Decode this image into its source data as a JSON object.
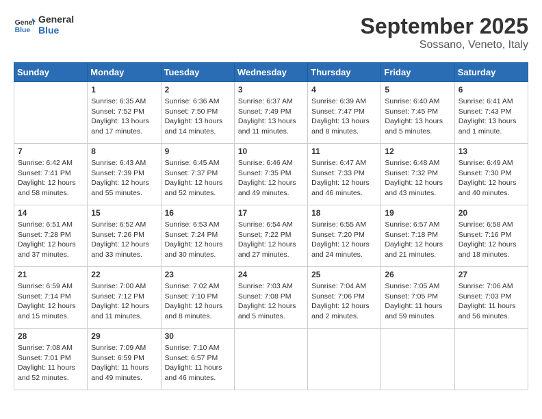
{
  "logo": {
    "text_general": "General",
    "text_blue": "Blue"
  },
  "header": {
    "month": "September 2025",
    "location": "Sossano, Veneto, Italy"
  },
  "weekdays": [
    "Sunday",
    "Monday",
    "Tuesday",
    "Wednesday",
    "Thursday",
    "Friday",
    "Saturday"
  ],
  "weeks": [
    [
      {
        "day": "",
        "sunrise": "",
        "sunset": "",
        "daylight": ""
      },
      {
        "day": "1",
        "sunrise": "Sunrise: 6:35 AM",
        "sunset": "Sunset: 7:52 PM",
        "daylight": "Daylight: 13 hours and 17 minutes."
      },
      {
        "day": "2",
        "sunrise": "Sunrise: 6:36 AM",
        "sunset": "Sunset: 7:50 PM",
        "daylight": "Daylight: 13 hours and 14 minutes."
      },
      {
        "day": "3",
        "sunrise": "Sunrise: 6:37 AM",
        "sunset": "Sunset: 7:49 PM",
        "daylight": "Daylight: 13 hours and 11 minutes."
      },
      {
        "day": "4",
        "sunrise": "Sunrise: 6:39 AM",
        "sunset": "Sunset: 7:47 PM",
        "daylight": "Daylight: 13 hours and 8 minutes."
      },
      {
        "day": "5",
        "sunrise": "Sunrise: 6:40 AM",
        "sunset": "Sunset: 7:45 PM",
        "daylight": "Daylight: 13 hours and 5 minutes."
      },
      {
        "day": "6",
        "sunrise": "Sunrise: 6:41 AM",
        "sunset": "Sunset: 7:43 PM",
        "daylight": "Daylight: 13 hours and 1 minute."
      }
    ],
    [
      {
        "day": "7",
        "sunrise": "Sunrise: 6:42 AM",
        "sunset": "Sunset: 7:41 PM",
        "daylight": "Daylight: 12 hours and 58 minutes."
      },
      {
        "day": "8",
        "sunrise": "Sunrise: 6:43 AM",
        "sunset": "Sunset: 7:39 PM",
        "daylight": "Daylight: 12 hours and 55 minutes."
      },
      {
        "day": "9",
        "sunrise": "Sunrise: 6:45 AM",
        "sunset": "Sunset: 7:37 PM",
        "daylight": "Daylight: 12 hours and 52 minutes."
      },
      {
        "day": "10",
        "sunrise": "Sunrise: 6:46 AM",
        "sunset": "Sunset: 7:35 PM",
        "daylight": "Daylight: 12 hours and 49 minutes."
      },
      {
        "day": "11",
        "sunrise": "Sunrise: 6:47 AM",
        "sunset": "Sunset: 7:33 PM",
        "daylight": "Daylight: 12 hours and 46 minutes."
      },
      {
        "day": "12",
        "sunrise": "Sunrise: 6:48 AM",
        "sunset": "Sunset: 7:32 PM",
        "daylight": "Daylight: 12 hours and 43 minutes."
      },
      {
        "day": "13",
        "sunrise": "Sunrise: 6:49 AM",
        "sunset": "Sunset: 7:30 PM",
        "daylight": "Daylight: 12 hours and 40 minutes."
      }
    ],
    [
      {
        "day": "14",
        "sunrise": "Sunrise: 6:51 AM",
        "sunset": "Sunset: 7:28 PM",
        "daylight": "Daylight: 12 hours and 37 minutes."
      },
      {
        "day": "15",
        "sunrise": "Sunrise: 6:52 AM",
        "sunset": "Sunset: 7:26 PM",
        "daylight": "Daylight: 12 hours and 33 minutes."
      },
      {
        "day": "16",
        "sunrise": "Sunrise: 6:53 AM",
        "sunset": "Sunset: 7:24 PM",
        "daylight": "Daylight: 12 hours and 30 minutes."
      },
      {
        "day": "17",
        "sunrise": "Sunrise: 6:54 AM",
        "sunset": "Sunset: 7:22 PM",
        "daylight": "Daylight: 12 hours and 27 minutes."
      },
      {
        "day": "18",
        "sunrise": "Sunrise: 6:55 AM",
        "sunset": "Sunset: 7:20 PM",
        "daylight": "Daylight: 12 hours and 24 minutes."
      },
      {
        "day": "19",
        "sunrise": "Sunrise: 6:57 AM",
        "sunset": "Sunset: 7:18 PM",
        "daylight": "Daylight: 12 hours and 21 minutes."
      },
      {
        "day": "20",
        "sunrise": "Sunrise: 6:58 AM",
        "sunset": "Sunset: 7:16 PM",
        "daylight": "Daylight: 12 hours and 18 minutes."
      }
    ],
    [
      {
        "day": "21",
        "sunrise": "Sunrise: 6:59 AM",
        "sunset": "Sunset: 7:14 PM",
        "daylight": "Daylight: 12 hours and 15 minutes."
      },
      {
        "day": "22",
        "sunrise": "Sunrise: 7:00 AM",
        "sunset": "Sunset: 7:12 PM",
        "daylight": "Daylight: 12 hours and 11 minutes."
      },
      {
        "day": "23",
        "sunrise": "Sunrise: 7:02 AM",
        "sunset": "Sunset: 7:10 PM",
        "daylight": "Daylight: 12 hours and 8 minutes."
      },
      {
        "day": "24",
        "sunrise": "Sunrise: 7:03 AM",
        "sunset": "Sunset: 7:08 PM",
        "daylight": "Daylight: 12 hours and 5 minutes."
      },
      {
        "day": "25",
        "sunrise": "Sunrise: 7:04 AM",
        "sunset": "Sunset: 7:06 PM",
        "daylight": "Daylight: 12 hours and 2 minutes."
      },
      {
        "day": "26",
        "sunrise": "Sunrise: 7:05 AM",
        "sunset": "Sunset: 7:05 PM",
        "daylight": "Daylight: 11 hours and 59 minutes."
      },
      {
        "day": "27",
        "sunrise": "Sunrise: 7:06 AM",
        "sunset": "Sunset: 7:03 PM",
        "daylight": "Daylight: 11 hours and 56 minutes."
      }
    ],
    [
      {
        "day": "28",
        "sunrise": "Sunrise: 7:08 AM",
        "sunset": "Sunset: 7:01 PM",
        "daylight": "Daylight: 11 hours and 52 minutes."
      },
      {
        "day": "29",
        "sunrise": "Sunrise: 7:09 AM",
        "sunset": "Sunset: 6:59 PM",
        "daylight": "Daylight: 11 hours and 49 minutes."
      },
      {
        "day": "30",
        "sunrise": "Sunrise: 7:10 AM",
        "sunset": "Sunset: 6:57 PM",
        "daylight": "Daylight: 11 hours and 46 minutes."
      },
      {
        "day": "",
        "sunrise": "",
        "sunset": "",
        "daylight": ""
      },
      {
        "day": "",
        "sunrise": "",
        "sunset": "",
        "daylight": ""
      },
      {
        "day": "",
        "sunrise": "",
        "sunset": "",
        "daylight": ""
      },
      {
        "day": "",
        "sunrise": "",
        "sunset": "",
        "daylight": ""
      }
    ]
  ]
}
